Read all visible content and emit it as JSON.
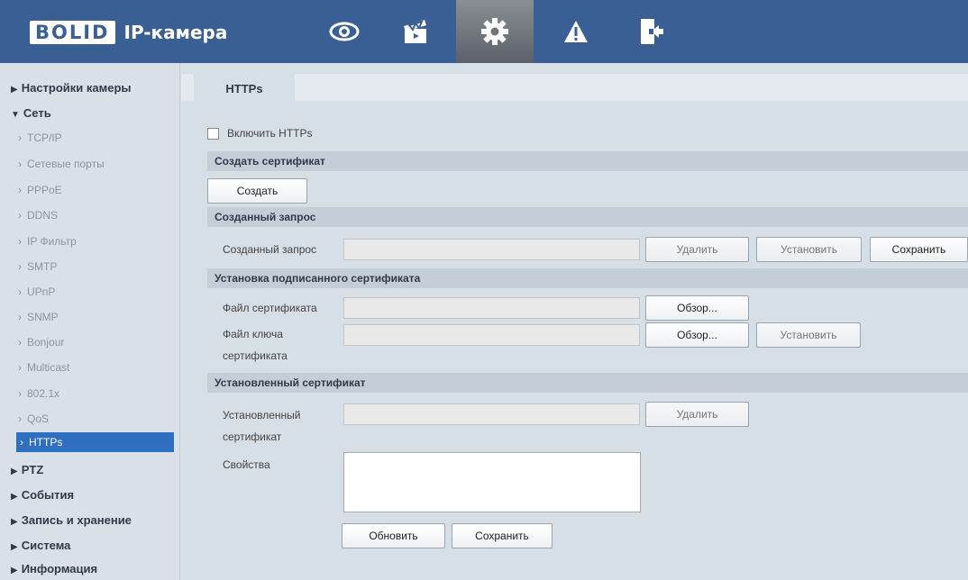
{
  "header": {
    "logo_text": "BOLID",
    "product": "IP-камера",
    "nav_icons": [
      "eye-icon",
      "clapperboard-icon",
      "gear-icon",
      "warning-icon",
      "exit-icon"
    ],
    "active_nav": "gear-icon"
  },
  "sidebar": {
    "top1": "Настройки камеры",
    "top2": "Сеть",
    "subs": [
      "TCP/IP",
      "Сетевые порты",
      "PPPoE",
      "DDNS",
      "IP Фильтр",
      "SMTP",
      "UPnP",
      "SNMP",
      "Bonjour",
      "Multicast",
      "802.1x",
      "QoS",
      "HTTPs"
    ],
    "bottom": [
      "PTZ",
      "События",
      "Запись и хранение",
      "Система",
      "Информация"
    ]
  },
  "tab": {
    "label": "HTTPs"
  },
  "form": {
    "enable_https": "Включить HTTPs",
    "section_create": "Создать сертификат",
    "create_button": "Создать",
    "section_request": "Созданный запрос",
    "request_label": "Созданный запрос",
    "delete_button": "Удалить",
    "install_button": "Установить",
    "save_button": "Сохранить",
    "section_signed": "Установка подписанного сертификата",
    "cert_file_label": "Файл сертификата",
    "browse_button": "Обзор...",
    "key_file_label_1": "Файл ключа",
    "key_file_label_2": "сертификата",
    "section_installed": "Установленный сертификат",
    "installed_label_1": "Установленный",
    "installed_label_2": "сертификат",
    "properties_label": "Свойства",
    "refresh_button": "Обновить",
    "save_bottom_button": "Сохранить"
  },
  "colors": {
    "header": "#3a5f94",
    "active_item": "#2f6fc0",
    "background": "#d6dee6"
  }
}
